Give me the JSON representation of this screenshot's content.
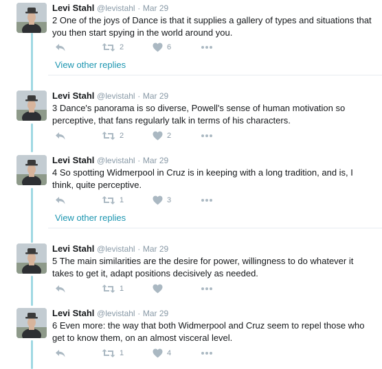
{
  "tweets": [
    {
      "name": "Levi Stahl",
      "handle": "@levistahl",
      "separator": "·",
      "date": "Mar 29",
      "text": "2 One of the joys of Dance is that it supplies a gallery of types and situations that you then start spying in the world around you.",
      "retweets": "2",
      "likes": "6"
    },
    {
      "name": "Levi Stahl",
      "handle": "@levistahl",
      "separator": "·",
      "date": "Mar 29",
      "text": "3 Dance's panorama is so diverse, Powell's sense of human motivation so perceptive, that fans regularly talk in terms of his characters.",
      "retweets": "2",
      "likes": "2"
    },
    {
      "name": "Levi Stahl",
      "handle": "@levistahl",
      "separator": "·",
      "date": "Mar 29",
      "text": "4 So spotting Widmerpool in Cruz is in keeping with a long tradition, and is, I think, quite perceptive.",
      "retweets": "1",
      "likes": "3"
    },
    {
      "name": "Levi Stahl",
      "handle": "@levistahl",
      "separator": "·",
      "date": "Mar 29",
      "text": "5 The main similarities are the desire for power, willingness to do whatever it takes to get it, adapt positions decisively as needed.",
      "retweets": "1",
      "likes": ""
    },
    {
      "name": "Levi Stahl",
      "handle": "@levistahl",
      "separator": "·",
      "date": "Mar 29",
      "text": "6 Even more: the way that both Widmerpool and Cruz seem to repel those who get to know them, on an almost visceral level.",
      "retweets": "1",
      "likes": "4"
    }
  ],
  "view_other_replies_label": "View other replies",
  "icons": {
    "reply": "reply-icon",
    "retweet": "retweet-icon",
    "like": "heart-icon",
    "more": "more-icon"
  },
  "colors": {
    "thread_line": "#9fd8e3",
    "link": "#1b95b0",
    "muted": "#8899a6",
    "icon": "#aab8c2"
  }
}
